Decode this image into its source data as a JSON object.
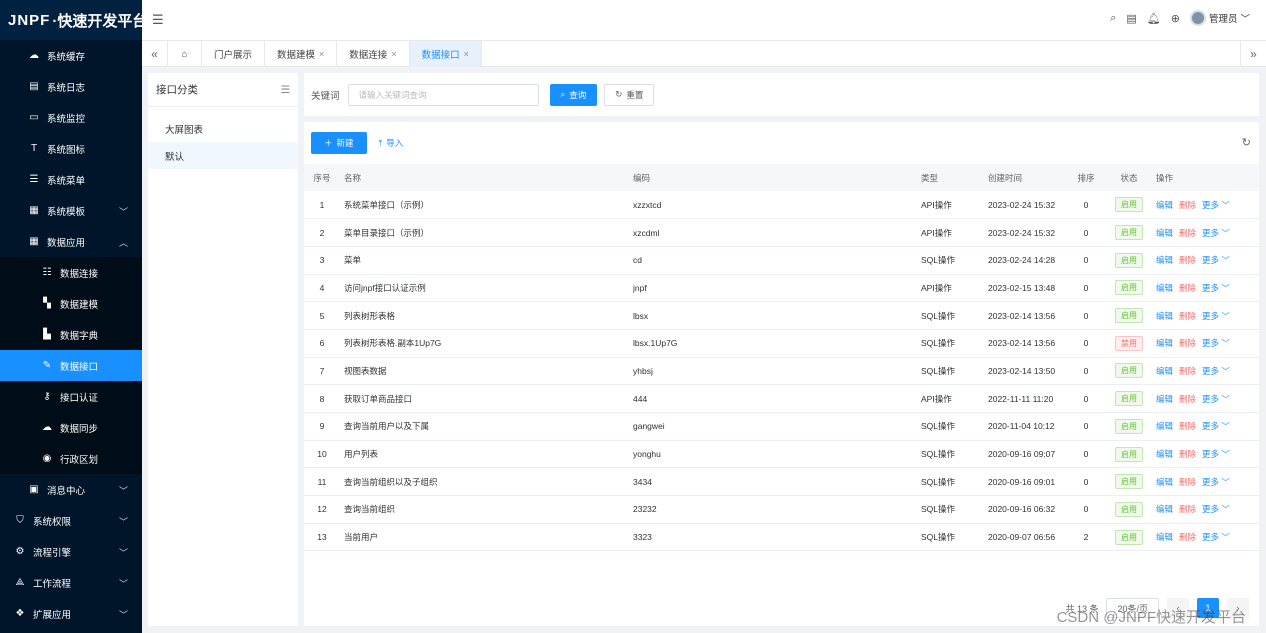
{
  "brand": {
    "logo_mark": "JNPF",
    "logo_text": "·快速开发平台"
  },
  "sidebar": {
    "items": [
      {
        "label": "系统缓存",
        "icon": "cloud-icon",
        "glyph": "☁",
        "level": "l1"
      },
      {
        "label": "系统日志",
        "icon": "log-icon",
        "glyph": "▤",
        "level": "l1"
      },
      {
        "label": "系统监控",
        "icon": "monitor-icon",
        "glyph": "▭",
        "level": "l1"
      },
      {
        "label": "系统图标",
        "icon": "icon-library-icon",
        "glyph": "T",
        "level": "l1"
      },
      {
        "label": "系统菜单",
        "icon": "menu-list-icon",
        "glyph": "☰",
        "level": "l1"
      },
      {
        "label": "系统模板",
        "icon": "template-icon",
        "glyph": "▦",
        "level": "l1",
        "arrow": "﹀"
      },
      {
        "label": "数据应用",
        "icon": "data-app-icon",
        "glyph": "▦",
        "level": "l1",
        "arrow": "︿"
      },
      {
        "label": "数据连接",
        "icon": "data-connect-icon",
        "glyph": "☷",
        "level": "sub"
      },
      {
        "label": "数据建模",
        "icon": "data-model-icon",
        "glyph": "▚",
        "level": "sub"
      },
      {
        "label": "数据字典",
        "icon": "dictionary-icon",
        "glyph": "▙",
        "level": "sub"
      },
      {
        "label": "数据接口",
        "icon": "data-interface-icon",
        "glyph": "✎",
        "level": "sub",
        "active": true
      },
      {
        "label": "接口认证",
        "icon": "key-icon",
        "glyph": "⚷",
        "level": "sub"
      },
      {
        "label": "数据同步",
        "icon": "sync-cloud-icon",
        "glyph": "☁",
        "level": "sub"
      },
      {
        "label": "行政区划",
        "icon": "region-icon",
        "glyph": "◉",
        "level": "sub"
      },
      {
        "label": "消息中心",
        "icon": "message-icon",
        "glyph": "▣",
        "level": "l1",
        "arrow": "﹀"
      },
      {
        "label": "系统权限",
        "icon": "shield-icon",
        "glyph": "⛉",
        "level": "top",
        "arrow": "﹀"
      },
      {
        "label": "流程引擎",
        "icon": "flow-engine-icon",
        "glyph": "⚙",
        "level": "top",
        "arrow": "﹀"
      },
      {
        "label": "工作流程",
        "icon": "workflow-icon",
        "glyph": "⟁",
        "level": "top",
        "arrow": "﹀"
      },
      {
        "label": "扩展应用",
        "icon": "extend-icon",
        "glyph": "❖",
        "level": "top",
        "arrow": "﹀"
      }
    ]
  },
  "header": {
    "user_name": "管理员"
  },
  "tabs": [
    {
      "label": "门户展示",
      "closable": false
    },
    {
      "label": "数据建模",
      "closable": true
    },
    {
      "label": "数据连接",
      "closable": true
    },
    {
      "label": "数据接口",
      "closable": true,
      "active": true
    }
  ],
  "category": {
    "title": "接口分类",
    "items": [
      {
        "label": "大屏图表"
      },
      {
        "label": "默认",
        "selected": true
      }
    ]
  },
  "search": {
    "label": "关键词",
    "placeholder": "请输入关键词查询",
    "query_label": "查询",
    "reset_label": "重置"
  },
  "toolbar": {
    "new_label": "新建",
    "import_label": "导入"
  },
  "table": {
    "headers": [
      "序号",
      "名称",
      "编码",
      "类型",
      "创建时间",
      "排序",
      "状态",
      "操作"
    ],
    "rows": [
      [
        "1",
        "系统菜单接口（示例）",
        "xzzxtcd",
        "API操作",
        "2023-02-24 15:32",
        "0",
        "启用"
      ],
      [
        "2",
        "菜单目录接口（示例）",
        "xzcdml",
        "API操作",
        "2023-02-24 15:32",
        "0",
        "启用"
      ],
      [
        "3",
        "菜单",
        "cd",
        "SQL操作",
        "2023-02-24 14:28",
        "0",
        "启用"
      ],
      [
        "4",
        "访问jnpf接口认证示例",
        "jnpf",
        "API操作",
        "2023-02-15 13:48",
        "0",
        "启用"
      ],
      [
        "5",
        "列表树形表格",
        "lbsx",
        "SQL操作",
        "2023-02-14 13:56",
        "0",
        "启用"
      ],
      [
        "6",
        "列表树形表格.副本1Up7G",
        "lbsx.1Up7G",
        "SQL操作",
        "2023-02-14 13:56",
        "0",
        "禁用"
      ],
      [
        "7",
        "视图表数据",
        "yhbsj",
        "SQL操作",
        "2023-02-14 13:50",
        "0",
        "启用"
      ],
      [
        "8",
        "获取订单商品接口",
        "444",
        "API操作",
        "2022-11-11 11:20",
        "0",
        "启用"
      ],
      [
        "9",
        "查询当前用户以及下属",
        "gangwei",
        "SQL操作",
        "2020-11-04 10:12",
        "0",
        "启用"
      ],
      [
        "10",
        "用户列表",
        "yonghu",
        "SQL操作",
        "2020-09-16 09:07",
        "0",
        "启用"
      ],
      [
        "11",
        "查询当前组织以及子组织",
        "3434",
        "SQL操作",
        "2020-09-16 09:01",
        "0",
        "启用"
      ],
      [
        "12",
        "查询当前组织",
        "23232",
        "SQL操作",
        "2020-09-16 06:32",
        "0",
        "启用"
      ],
      [
        "13",
        "当前用户",
        "3323",
        "SQL操作",
        "2020-09-07 06:56",
        "2",
        "启用"
      ]
    ],
    "ops": {
      "edit": "编辑",
      "delete": "删除",
      "more": "更多"
    }
  },
  "pagination": {
    "total": "共 13 条",
    "page_size": "20条/页",
    "current": "1"
  },
  "watermark": "CSDN @JNPF快速开发平台",
  "colors": {
    "primary": "#1890ff",
    "sidebar_bg": "#001529",
    "danger": "#f56c6c",
    "success": "#67c23a"
  }
}
